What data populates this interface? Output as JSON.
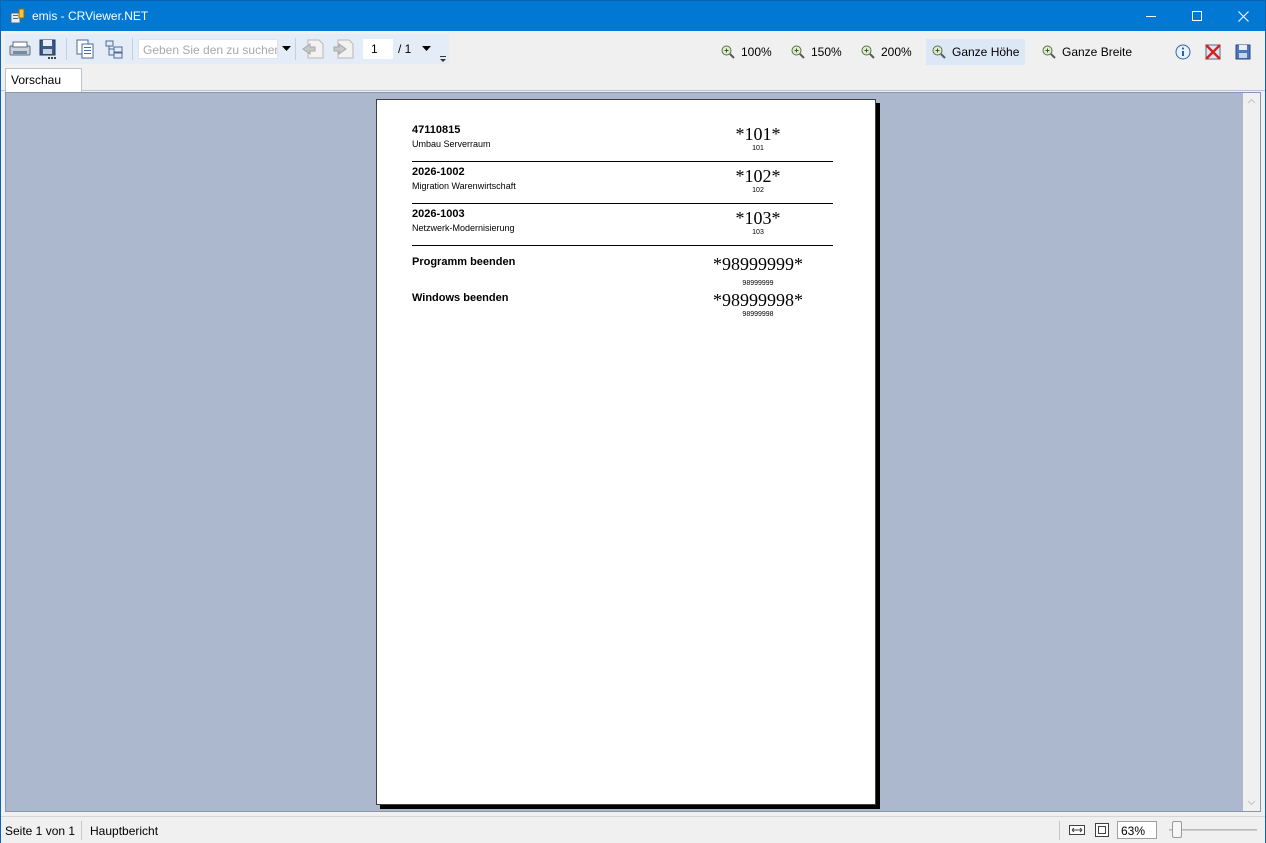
{
  "window": {
    "title": "emis - CRViewer.NET",
    "accent": "#0078d4"
  },
  "toolbar": {
    "search_placeholder": "Geben Sie den zu suchen",
    "page_current": "1",
    "page_total": "/ 1",
    "zoom": [
      {
        "label": "100%"
      },
      {
        "label": "150%"
      },
      {
        "label": "200%"
      },
      {
        "label": "Ganze Höhe"
      },
      {
        "label": "Ganze Breite"
      }
    ]
  },
  "tabs": [
    {
      "label": "Vorschau"
    }
  ],
  "report": {
    "entries": [
      {
        "code": "47110815",
        "desc": "Umbau Serverraum",
        "barcode": "*101*",
        "barcode_text": "101"
      },
      {
        "code": "2026-1002",
        "desc": "Migration Warenwirtschaft",
        "barcode": "*102*",
        "barcode_text": "102"
      },
      {
        "code": "2026-1003",
        "desc": "Netzwerk-Modernisierung",
        "barcode": "*103*",
        "barcode_text": "103"
      }
    ],
    "commands": [
      {
        "label": "Programm beenden",
        "barcode": "*98999999*",
        "barcode_text": "98999999"
      },
      {
        "label": "Windows beenden",
        "barcode": "*98999998*",
        "barcode_text": "98999998"
      }
    ]
  },
  "statusbar": {
    "page_info": "Seite 1 von 1",
    "report_name": "Hauptbericht",
    "zoom_value": "63%"
  },
  "icons": {
    "print": "printer-icon",
    "export": "export-icon",
    "copy": "copy-icon",
    "group_tree": "group-tree-icon",
    "prev_page": "previous-page-icon",
    "next_page": "next-page-icon",
    "zoom": "magnifier-icon",
    "about": "info-icon",
    "close_report": "close-report-icon",
    "save": "save-icon"
  }
}
